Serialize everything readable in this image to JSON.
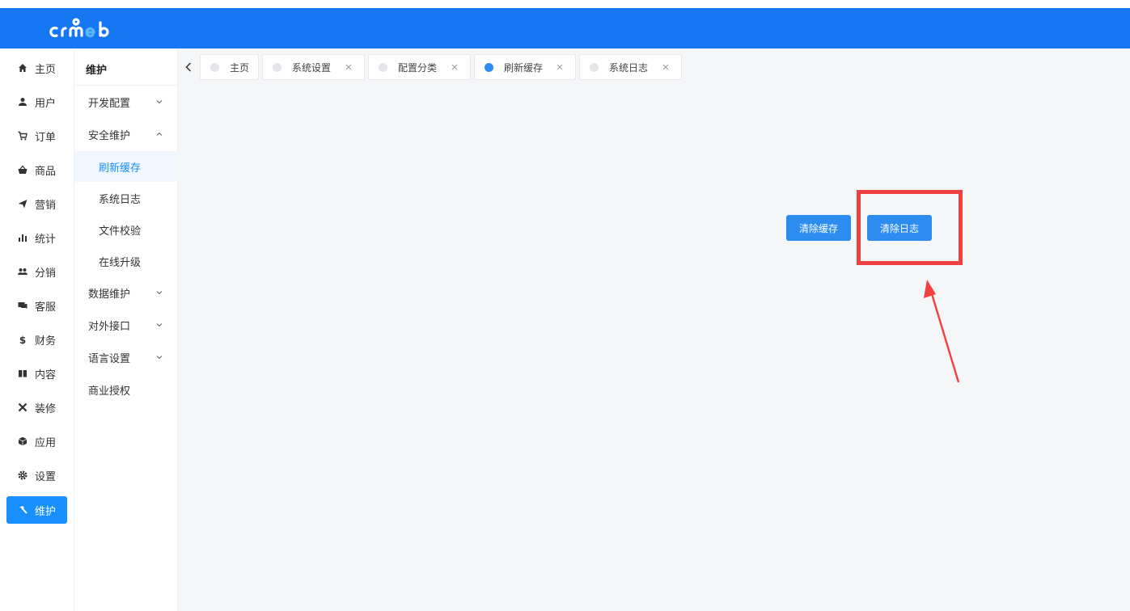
{
  "brand": {
    "logo_text": "crmeb",
    "header_color": "#1677f2",
    "accent": "#1890ff"
  },
  "sidebar": {
    "items": [
      {
        "label": "主页",
        "icon": "home-icon"
      },
      {
        "label": "用户",
        "icon": "user-icon"
      },
      {
        "label": "订单",
        "icon": "cart-icon"
      },
      {
        "label": "商品",
        "icon": "basket-icon"
      },
      {
        "label": "营销",
        "icon": "send-icon"
      },
      {
        "label": "统计",
        "icon": "bar-chart-icon"
      },
      {
        "label": "分销",
        "icon": "group-icon"
      },
      {
        "label": "客服",
        "icon": "chat-icon"
      },
      {
        "label": "财务",
        "icon": "dollar-icon"
      },
      {
        "label": "内容",
        "icon": "book-icon"
      },
      {
        "label": "装修",
        "icon": "tools-icon"
      },
      {
        "label": "应用",
        "icon": "cube-icon"
      },
      {
        "label": "设置",
        "icon": "gear-icon"
      },
      {
        "label": "维护",
        "icon": "hammer-icon",
        "active": true
      }
    ]
  },
  "submenu": {
    "title": "维护",
    "items": [
      {
        "label": "开发配置",
        "type": "parent",
        "expanded": false
      },
      {
        "label": "安全维护",
        "type": "parent",
        "expanded": true
      },
      {
        "label": "刷新缓存",
        "type": "child",
        "selected": true
      },
      {
        "label": "系统日志",
        "type": "child"
      },
      {
        "label": "文件校验",
        "type": "child"
      },
      {
        "label": "在线升级",
        "type": "child"
      },
      {
        "label": "数据维护",
        "type": "parent",
        "expanded": false
      },
      {
        "label": "对外接口",
        "type": "parent",
        "expanded": false
      },
      {
        "label": "语言设置",
        "type": "parent",
        "expanded": false
      },
      {
        "label": "商业授权",
        "type": "leaf"
      }
    ]
  },
  "tabs": [
    {
      "label": "主页",
      "closable": false
    },
    {
      "label": "系统设置",
      "closable": true
    },
    {
      "label": "配置分类",
      "closable": true
    },
    {
      "label": "刷新缓存",
      "closable": true,
      "active": true
    },
    {
      "label": "系统日志",
      "closable": true
    }
  ],
  "actions": {
    "clear_cache_label": "清除缓存",
    "clear_log_label": "清除日志"
  },
  "annotation": {
    "color": "#f24040"
  }
}
